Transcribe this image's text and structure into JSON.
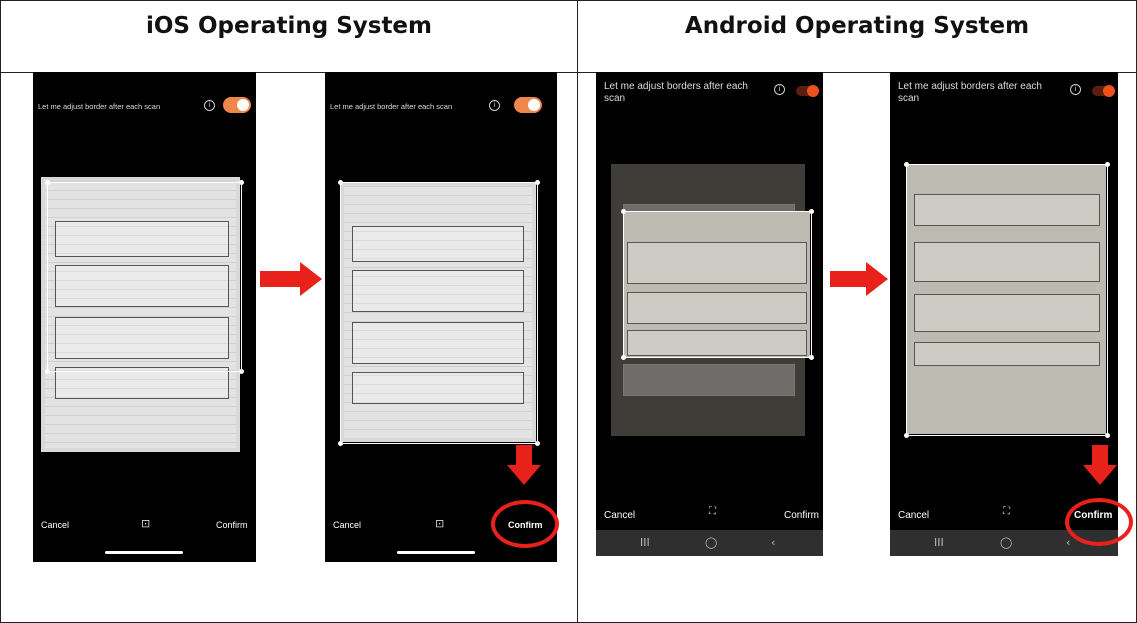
{
  "columns": {
    "ios_title": "iOS Operating System",
    "android_title": "Android Operating System"
  },
  "ios": {
    "toggle_label": "Let me adjust border after each scan",
    "cancel": "Cancel",
    "confirm": "Confirm",
    "toggle_on": true,
    "accent": "#f0874a"
  },
  "android": {
    "toggle_label": "Let me adjust borders after each scan",
    "cancel": "Cancel",
    "confirm": "Confirm",
    "toggle_on": true,
    "accent": "#f0501e",
    "nav": [
      "III",
      "◯",
      "‹"
    ]
  },
  "annotations": {
    "arrow_color": "#e8211b"
  },
  "icons": [
    "info-icon",
    "toggle-switch",
    "crop-expand-icon",
    "right-arrow",
    "down-arrow",
    "highlight-circle"
  ]
}
